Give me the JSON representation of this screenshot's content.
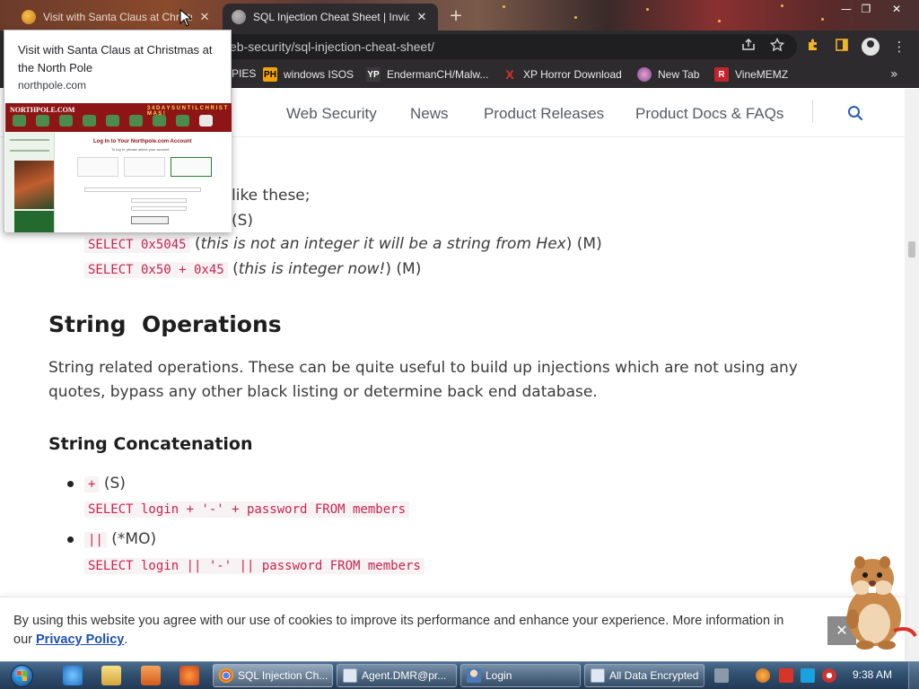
{
  "browser": {
    "tabs": [
      {
        "title": "Visit with Santa Claus at Christmas",
        "active": false
      },
      {
        "title": "SQL Injection Cheat Sheet | Invicti",
        "active": true
      }
    ],
    "new_tab": "+",
    "close_glyph": "✕",
    "window_controls": [
      "—",
      "❐",
      "✕"
    ],
    "url": "eb-security/sql-injection-cheat-sheet/",
    "toolbar_icons": [
      "share-icon",
      "star-icon",
      "extensions-icon",
      "sidebar-icon",
      "profile-icon",
      "menu-icon"
    ],
    "menu_glyph": "⋮",
    "bookmarks": [
      {
        "label": "PIES",
        "icon": ""
      },
      {
        "label": "windows ISOS",
        "icon": "PH"
      },
      {
        "label": "EndermanCH/Malw...",
        "icon": "YP"
      },
      {
        "label": "XP Horror Download",
        "icon": "X"
      },
      {
        "label": "New Tab",
        "icon": ""
      },
      {
        "label": "VineMEMZ",
        "icon": "R"
      }
    ],
    "bookmarks_more": "»"
  },
  "hover_preview": {
    "title": "Visit with Santa Claus at Christmas at the North Pole",
    "domain": "northpole.com",
    "thumb": {
      "logo": "NORTHPOLE.COM",
      "days": "3 4   D A Y S   U N T I L   C H R I S T M A S !",
      "heading": "Log In to Your Northpole.com Account",
      "subheading": "To log in, please select your account",
      "option_selected": "Child/ Student",
      "user_value": "aswd \"from mem",
      "button": "Log In",
      "caption": "North Pole Christmas Stories"
    }
  },
  "site_nav": {
    "links": [
      "Web Security",
      "News",
      "Product Releases",
      "Product Docs & FAQs"
    ],
    "search_icon": "search-icon"
  },
  "article": {
    "partial_line1": "like these;",
    "partial_line2": "(S)",
    "hex_line1": {
      "code": "SELECT 0x5045",
      "paren_open": " (",
      "italic": "this is not an integer it will be a string from Hex",
      "paren_close": ")",
      "tag": " (M)"
    },
    "hex_line2": {
      "code": "SELECT 0x50 + 0x45",
      "paren_open": " (",
      "italic": "this is integer now!",
      "paren_close": ")",
      "tag": " (M)"
    },
    "section_title": "String  Operations",
    "section_text_1": "String related operations. These can be quite useful to build up injections which are not using any",
    "section_text_2": "quotes, bypass any other black listing or determine back end database.",
    "subsection_title": "String Concatenation",
    "items": [
      {
        "op": "+",
        "tag": " (S)",
        "example": "SELECT login + '-' + password FROM members"
      },
      {
        "op": "||",
        "tag": " (*MO)",
        "example": "SELECT login || '-' || password FROM members"
      }
    ]
  },
  "cookie_banner": {
    "text_1": "By using this website you agree with our use of cookies to improve its performance and enhance your experience. More information in",
    "text_2_prefix": "our ",
    "privacy_link": "Privacy Policy",
    "text_2_suffix": ".",
    "dismiss": "✕"
  },
  "taskbar": {
    "buttons": [
      {
        "label": "SQL Injection Ch...",
        "icon": "chrome-icon",
        "active": true
      },
      {
        "label": "Agent.DMR@pr...",
        "icon": "app-icon",
        "active": false
      },
      {
        "label": "Login",
        "icon": "user-icon",
        "active": false
      },
      {
        "label": "All Data Encrypted",
        "icon": "window-icon",
        "active": false
      }
    ],
    "clock": "9:38 AM"
  },
  "colors": {
    "code_text": "#c7254e",
    "link": "#1b4fb3",
    "nav_text": "#555a66",
    "chrome_dark": "#2d2b2e",
    "search_blue": "#2a5db0"
  }
}
